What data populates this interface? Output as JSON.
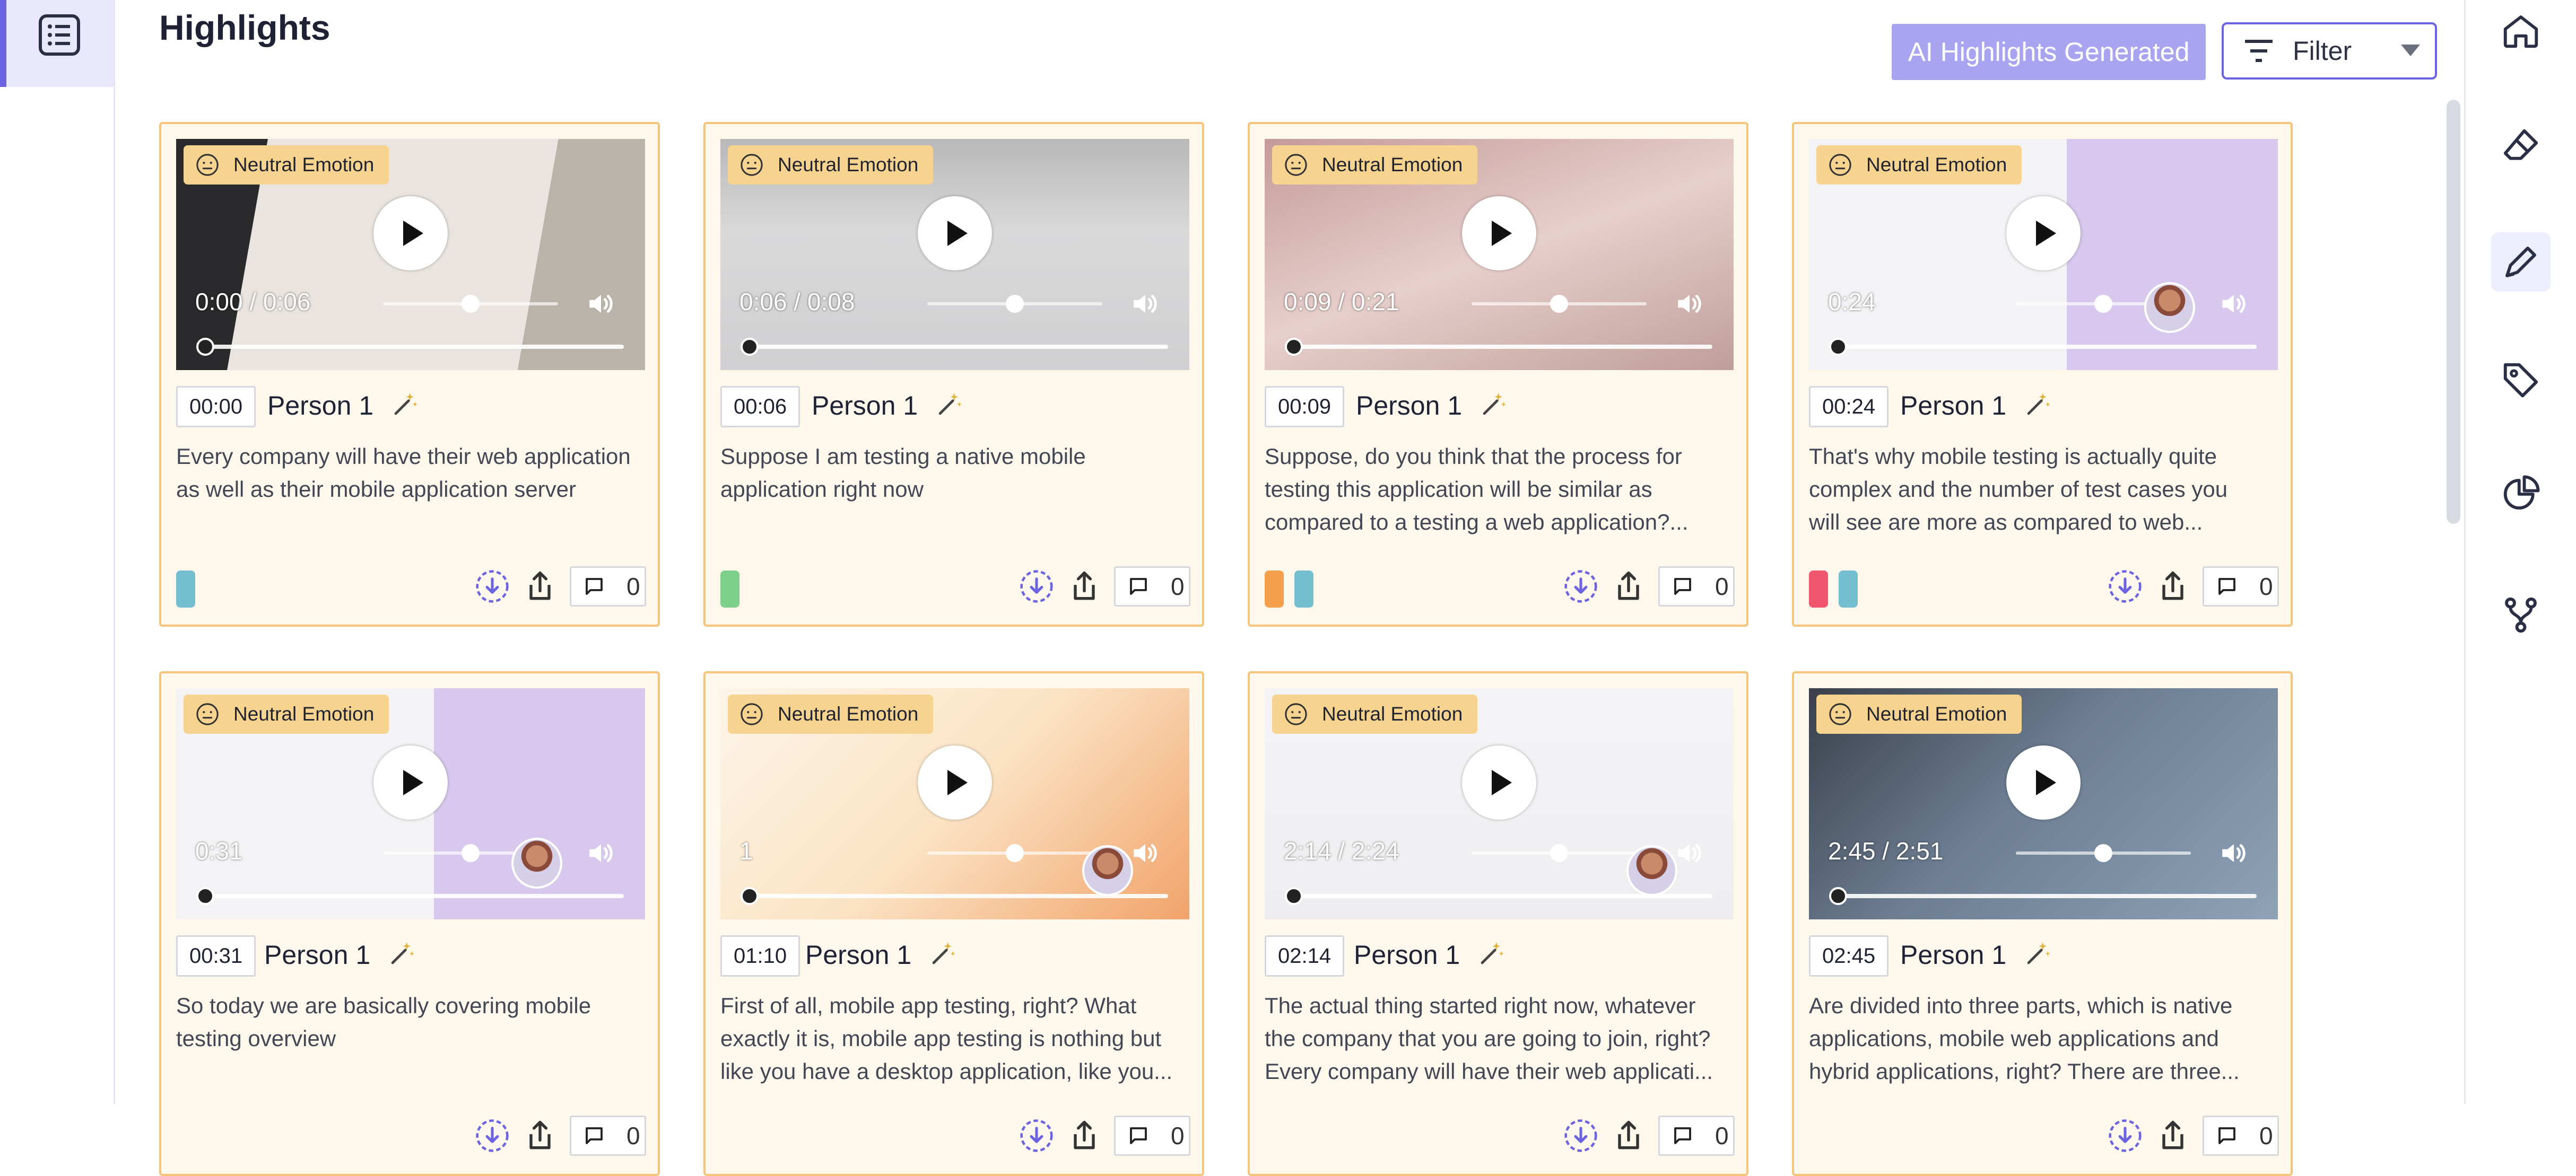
{
  "header": {
    "title": "Highlights",
    "ai_badge": "AI Highlights Generated",
    "filter_label": "Filter"
  },
  "colors": {
    "accent": "#6c63e0",
    "card_border": "#f5c57b",
    "card_bg": "#fef7ec",
    "emotion_badge": "#f6d38f",
    "tag_blue": "#74bfcf",
    "tag_green": "#7fd08a",
    "tag_orange": "#f5a04d",
    "tag_red": "#f0566e"
  },
  "cards": [
    {
      "emotion": "Neutral Emotion",
      "video_time": "0:00 / 0:06",
      "volume": 0.5,
      "timestamp": "00:00",
      "speaker": "Person 1",
      "quote_lines": [
        "Every company will have their web application",
        "as well as their mobile application server"
      ],
      "tags": [
        "blue"
      ],
      "comment_count": "0"
    },
    {
      "emotion": "Neutral Emotion",
      "video_time": "0:06 / 0:08",
      "volume": 0.5,
      "timestamp": "00:06",
      "speaker": "Person 1",
      "quote_lines": [
        "Suppose I am testing a native mobile",
        "application right now"
      ],
      "tags": [
        "green"
      ],
      "comment_count": "0"
    },
    {
      "emotion": "Neutral Emotion",
      "video_time": "0:09 / 0:21",
      "volume": 0.5,
      "timestamp": "00:09",
      "speaker": "Person 1",
      "quote_lines": [
        "Suppose, do you think that the process for",
        "testing this application will be similar as",
        "compared to a testing a web application?..."
      ],
      "tags": [
        "orange",
        "blue"
      ],
      "comment_count": "0"
    },
    {
      "emotion": "Neutral Emotion",
      "video_time": "0:24",
      "volume": 0.5,
      "timestamp": "00:24",
      "speaker": "Person 1",
      "quote_lines": [
        "That's why mobile testing is actually quite",
        "complex and the number of test cases you",
        "will see are more as compared to web..."
      ],
      "tags": [
        "red",
        "blue"
      ],
      "comment_count": "0"
    },
    {
      "emotion": "Neutral Emotion",
      "video_time": "0:31",
      "volume": 0.5,
      "timestamp": "00:31",
      "speaker": "Person 1",
      "quote_lines": [
        "So today we are basically covering mobile",
        "testing overview"
      ],
      "tags": [],
      "comment_count": "0"
    },
    {
      "emotion": "Neutral Emotion",
      "video_time": "1",
      "volume": 0.5,
      "timestamp": "01:10",
      "speaker": "Person 1",
      "quote_lines": [
        "First of all, mobile app testing, right? What",
        "exactly it is, mobile app testing is nothing but",
        "like you have a desktop application, like you..."
      ],
      "tags": [],
      "comment_count": "0"
    },
    {
      "emotion": "Neutral Emotion",
      "video_time": "2:14 / 2:24",
      "volume": 0.5,
      "timestamp": "02:14",
      "speaker": "Person 1",
      "quote_lines": [
        "The actual thing started right now, whatever",
        "the company that you are going to join, right?",
        "Every company will have their web applicati..."
      ],
      "tags": [],
      "comment_count": "0"
    },
    {
      "emotion": "Neutral Emotion",
      "video_time": "2:45 / 2:51",
      "volume": 0.5,
      "timestamp": "02:45",
      "speaker": "Person 1",
      "quote_lines": [
        "Are divided into three parts, which is native",
        "applications, mobile web applications and",
        "hybrid applications, right? There are three..."
      ],
      "tags": [],
      "comment_count": "0"
    }
  ]
}
